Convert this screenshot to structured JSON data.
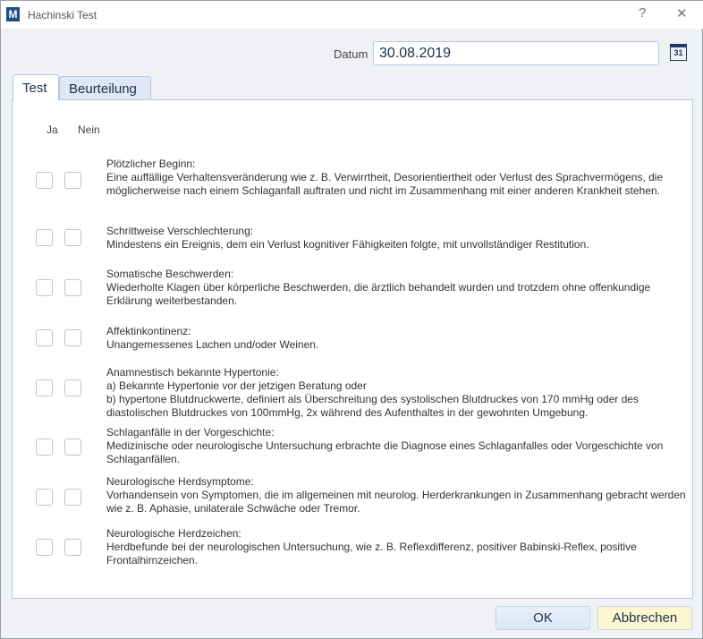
{
  "window": {
    "title": "Hachinski Test",
    "logo": "M",
    "help": "?",
    "close": "✕"
  },
  "datum": {
    "label": "Datum",
    "value": "30.08.2019",
    "calendar_day": "31"
  },
  "tabs": [
    {
      "label": "Test",
      "active": true
    },
    {
      "label": "Beurteilung",
      "active": false
    }
  ],
  "columns": {
    "yes": "Ja",
    "no": "Nein"
  },
  "items": [
    {
      "title": "Plötzlicher Beginn:",
      "desc": "Eine auffällige Verhaltensveränderung wie z. B. Verwirrtheit, Desorientiertheit oder Verlust des Sprachvermögens, die möglicherweise nach einem Schlaganfall auftraten und nicht im Zusammenhang mit einer anderen Krankheit stehen."
    },
    {
      "title": "Schrittweise Verschlechterung:",
      "desc": "Mindestens ein Ereignis, dem ein Verlust kognitiver Fähigkeiten folgte, mit unvollständiger Restitution."
    },
    {
      "title": "Somatische Beschwerden:",
      "desc": "Wiederholte Klagen über körperliche Beschwerden, die ärztlich behandelt wurden und trotzdem ohne offenkundige Erklärung weiterbestanden."
    },
    {
      "title": "Affektinkontinenz:",
      "desc": "Unangemessenes Lachen und/oder Weinen."
    },
    {
      "title": "Anamnestisch bekannte Hypertonie:",
      "desc": "a) Bekannte Hypertonie vor der jetzigen Beratung oder\nb) hypertone Blutdruckwerte, definiert als Überschreitung des systolischen Blutdruckes von 170 mmHg oder des diastolischen Blutdruckes von 100mmHg, 2x während des Aufenthaltes in der gewohnten Umgebung."
    },
    {
      "title": "Schlaganfälle in der Vorgeschichte:",
      "desc": "Medizinische oder neurologische Untersuchung erbrachte die Diagnose eines Schlaganfalles oder Vorgeschichte von Schlaganfällen."
    },
    {
      "title": "Neurologische Herdsymptome:",
      "desc": "Vorhandensein von Symptomen, die im allgemeinen mit neurolog. Herderkrankungen in Zusammenhang gebracht werden wie z. B. Aphasie, unilaterale Schwäche oder Tremor."
    },
    {
      "title": "Neurologische Herdzeichen:",
      "desc": "Herdbefunde bei der neurologischen Untersuchung, wie z. B. Reflexdifferenz, positiver Babinski-Reflex, positive Frontalhirnzeichen."
    }
  ],
  "buttons": {
    "ok": "OK",
    "cancel": "Abbrechen"
  }
}
